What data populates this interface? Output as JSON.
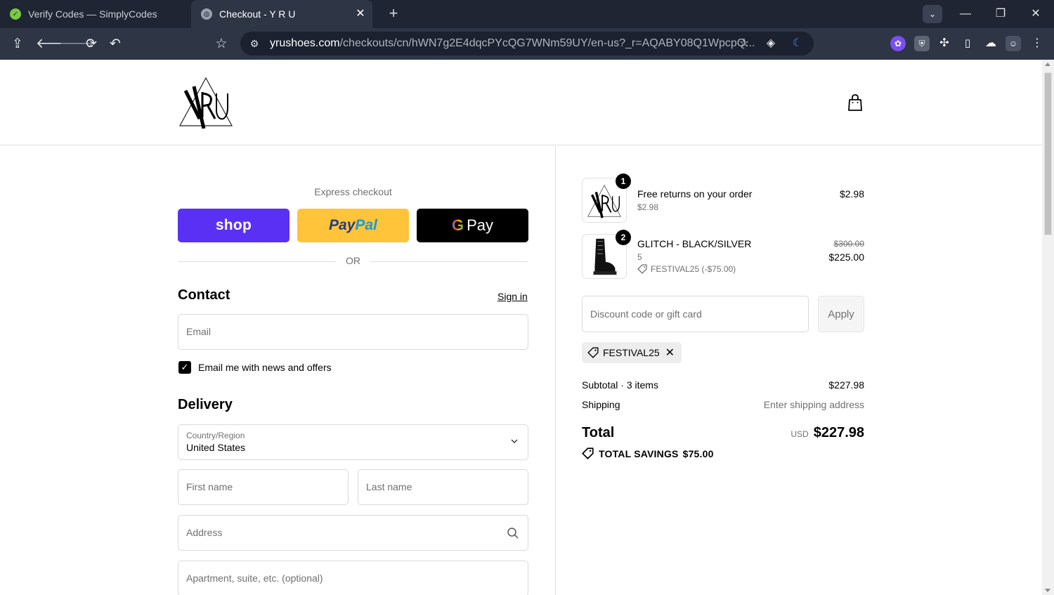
{
  "browser": {
    "tabs": [
      {
        "title": "Verify Codes — SimplyCodes",
        "active": false
      },
      {
        "title": "Checkout - Y R U",
        "active": true
      }
    ],
    "url_host": "yrushoes.com",
    "url_path": "/checkouts/cn/hWN7g2E4dqcPYcQG7WNm59UY/en-us?_r=AQABY08Q1WpcpQ..."
  },
  "store": {
    "logo_text": "YRU"
  },
  "express": {
    "label": "Express checkout",
    "shop_label": "shop",
    "paypal_part1": "Pay",
    "paypal_part2": "Pal",
    "gpay_g": "G",
    "gpay_label": "Pay",
    "or_label": "OR"
  },
  "contact": {
    "title": "Contact",
    "signin_label": "Sign in",
    "email_placeholder": "Email",
    "newsletter_label": "Email me with news and offers",
    "newsletter_checked": true
  },
  "delivery": {
    "title": "Delivery",
    "country_label": "Country/Region",
    "country_value": "United States",
    "first_name_placeholder": "First name",
    "last_name_placeholder": "Last name",
    "address_placeholder": "Address",
    "apartment_placeholder": "Apartment, suite, etc. (optional)"
  },
  "summary": {
    "items": [
      {
        "qty": "1",
        "name": "Free returns on your order",
        "sub": "$2.98",
        "price": "$2.98"
      },
      {
        "qty": "2",
        "name": "GLITCH - BLACK/SILVER",
        "sub": "5",
        "discount": "FESTIVAL25 (-$75.00)",
        "original_price": "$300.00",
        "price": "$225.00"
      }
    ],
    "discount_placeholder": "Discount code or gift card",
    "apply_label": "Apply",
    "applied_code": "FESTIVAL25",
    "subtotal_label": "Subtotal · 3 items",
    "subtotal_value": "$227.98",
    "shipping_label": "Shipping",
    "shipping_value": "Enter shipping address",
    "total_label": "Total",
    "total_currency": "USD",
    "total_value": "$227.98",
    "savings_label": "TOTAL SAVINGS",
    "savings_value": "$75.00"
  },
  "colors": {
    "shop": "#5a31f4",
    "paypal": "#ffc439",
    "gpay": "#000000"
  }
}
